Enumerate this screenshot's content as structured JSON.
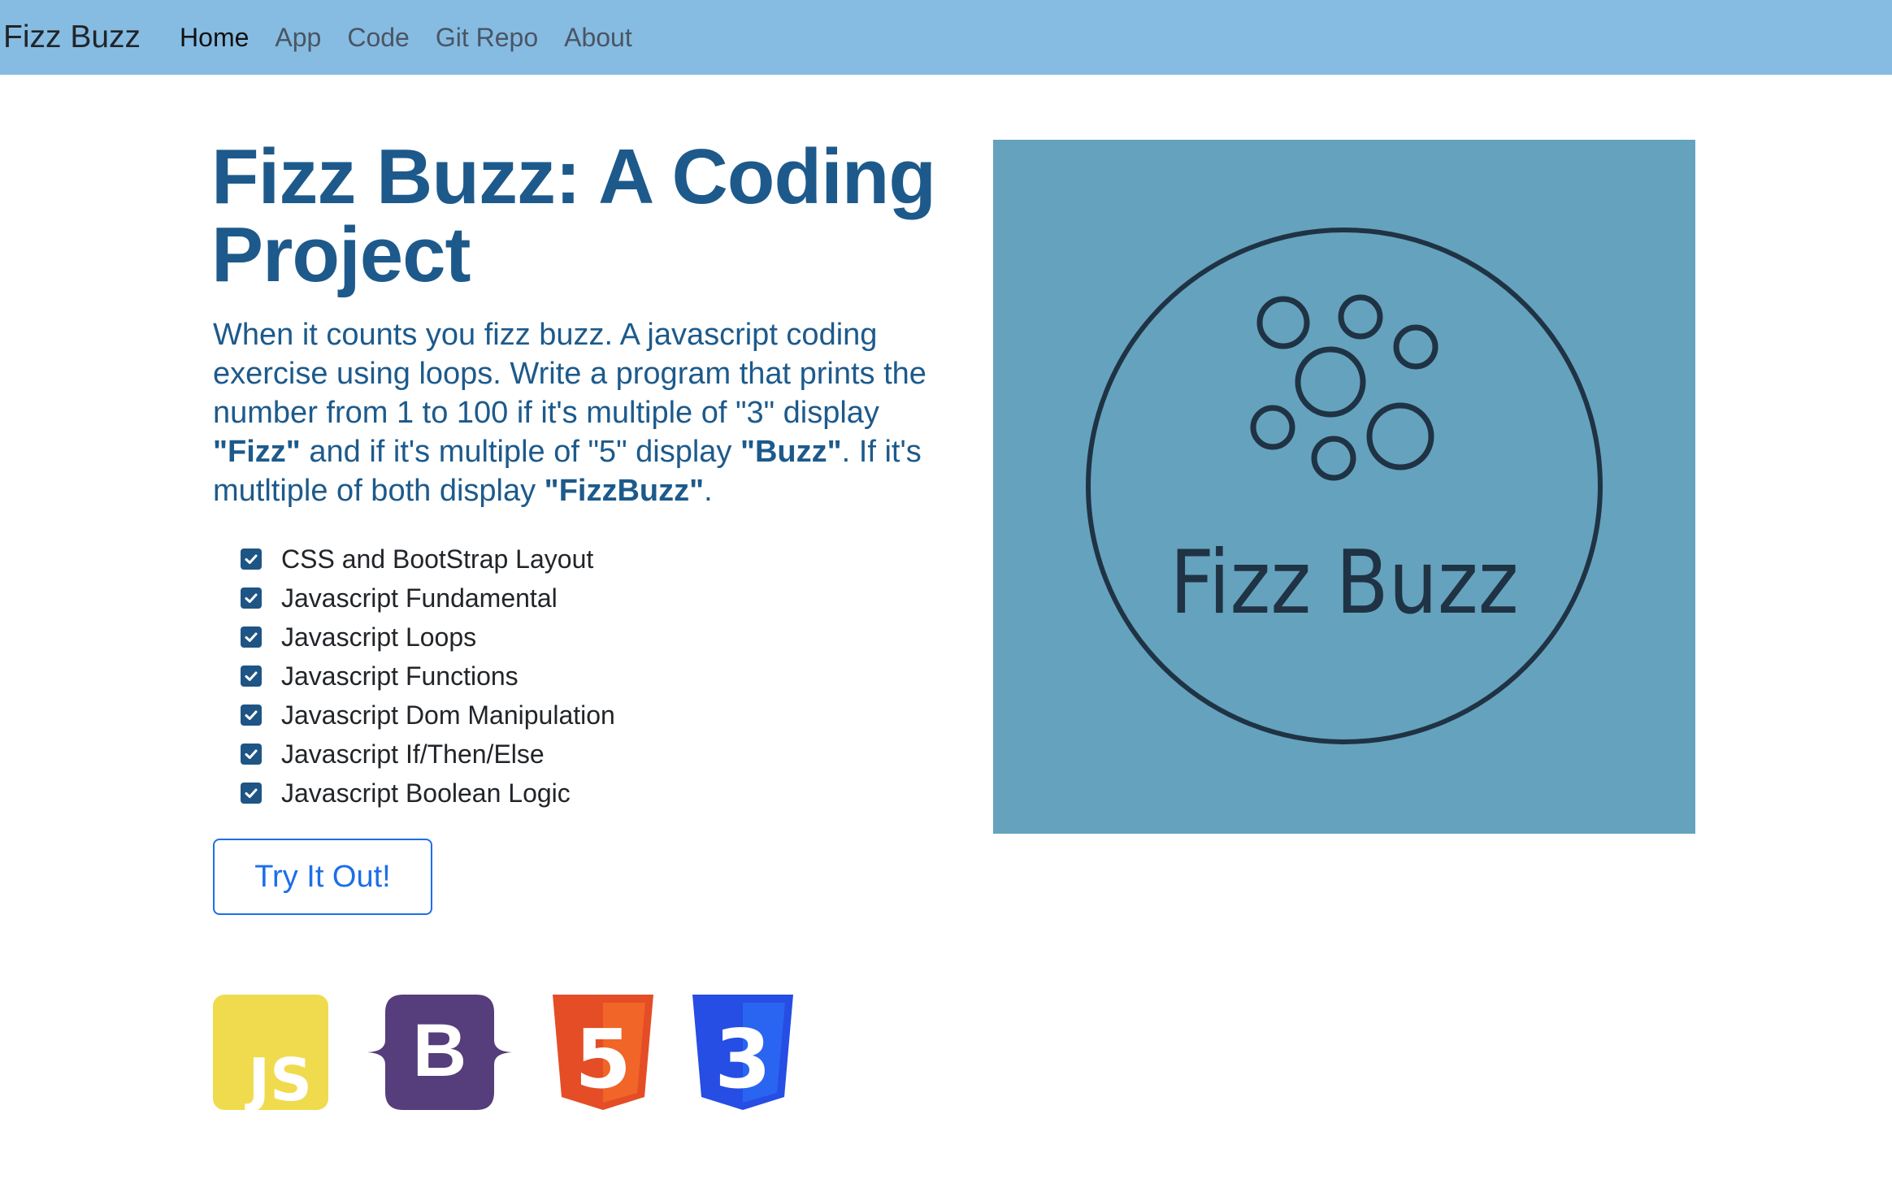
{
  "navbar": {
    "brand": "Fizz Buzz",
    "links": [
      {
        "label": "Home",
        "active": true
      },
      {
        "label": "App",
        "active": false
      },
      {
        "label": "Code",
        "active": false
      },
      {
        "label": "Git Repo",
        "active": false
      },
      {
        "label": "About",
        "active": false
      }
    ]
  },
  "hero": {
    "title": "Fizz Buzz: A Coding Project",
    "lead": {
      "part1": "When it counts you fizz buzz. A javascript coding exercise using loops. Write a program that prints the number from 1 to 100 if it's multiple of \"3\" display ",
      "fizz": "\"Fizz\"",
      "part2": " and if it's multiple of \"5\" display ",
      "buzz": "\"Buzz\"",
      "part3": ". If it's mutltiple of both display ",
      "fizzbuzz": "\"FizzBuzz\"",
      "part4": "."
    },
    "checklist": [
      "CSS and BootStrap Layout",
      "Javascript Fundamental",
      "Javascript Loops",
      "Javascript Functions",
      "Javascript Dom Manipulation",
      "Javascript If/Then/Else",
      "Javascript Boolean Logic"
    ],
    "cta_label": "Try It Out!",
    "tech_icons": [
      {
        "icon": "javascript-icon",
        "text": "JS",
        "color": "#f0db4f"
      },
      {
        "icon": "bootstrap-icon",
        "text": "B",
        "color": "#563d7c"
      },
      {
        "icon": "html5-icon",
        "text": "5",
        "color": "#e44d26"
      },
      {
        "icon": "css3-icon",
        "text": "3",
        "color": "#264de4"
      }
    ]
  },
  "logo_image": {
    "text": "Fizz Buzz",
    "background": "#65a2bd",
    "stroke": "#1f3344"
  },
  "colors": {
    "navbar": "#86bce2",
    "heading": "#1d5a8b",
    "button": "#1e6ee8",
    "checkbox": "#1e5585"
  }
}
